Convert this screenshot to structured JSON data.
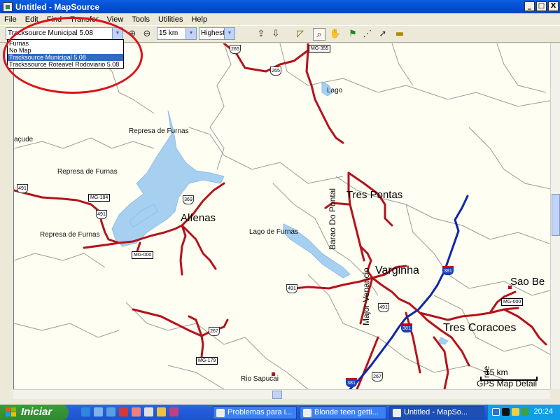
{
  "window": {
    "title": "Untitled - MapSource",
    "controls": [
      "_",
      "□",
      "X"
    ]
  },
  "menubar": {
    "items": [
      "File",
      "Edit",
      "Find",
      "Transfer",
      "View",
      "Tools",
      "Utilities",
      "Help"
    ]
  },
  "toolbar": {
    "product_combo": "Tracksource Municipal 5.08",
    "zoom_combo": "15 km",
    "detail_combo": "Highest",
    "tools": [
      "copy-to-device-icon",
      "receive-from-device-icon",
      "map-tool-icon",
      "zoom-tool-icon",
      "hand-tool-icon",
      "waypoint-tool-icon",
      "route-tool-icon",
      "selection-tool-icon",
      "measure-tool-icon"
    ]
  },
  "dropdown": {
    "options": [
      "Furnas",
      "No Map",
      "Tracksource Municipal 5.08",
      "Trackssource Roteavel Rodoviario 5.08"
    ],
    "selected_index": 2
  },
  "map": {
    "region_labels": [
      "açude",
      "Represa de Furnas",
      "Represa de Furnas",
      "Represa de Furnas",
      "Lago de Furnas",
      "Lago",
      "Rio Sapucai"
    ],
    "cities": [
      "Alfenas",
      "Tres Pontas",
      "Varginha",
      "Tres Coracoes",
      "Sao Be"
    ],
    "vertical_labels": [
      "Barao Do Pontal",
      "Major Venancio"
    ],
    "road_labels_state": [
      "MG-355",
      "MG-184",
      "MG-000",
      "MG-000",
      "MG-179"
    ],
    "road_labels_us": [
      "265",
      "265",
      "491",
      "491",
      "369",
      "491",
      "491",
      "267",
      "267"
    ],
    "road_labels_interstate": [
      "381",
      "381",
      "381"
    ],
    "edge_text": "rde",
    "scale_text": "15 km",
    "detail_text": "GPS Map Detail"
  },
  "taskbar": {
    "start_label": "Iniciar",
    "tasks": [
      "Problemas para i...",
      "Blonde teen getti...",
      "Untitled - MapSo..."
    ],
    "active_task_index": 2,
    "clock": "20:24"
  },
  "colors": {
    "road": "#b5121b",
    "interstate": "#1027a8",
    "water": "#a6cff0",
    "boundary": "#9a9a9a",
    "map_bg": "#fefef2",
    "annotation": "#d8141c"
  }
}
